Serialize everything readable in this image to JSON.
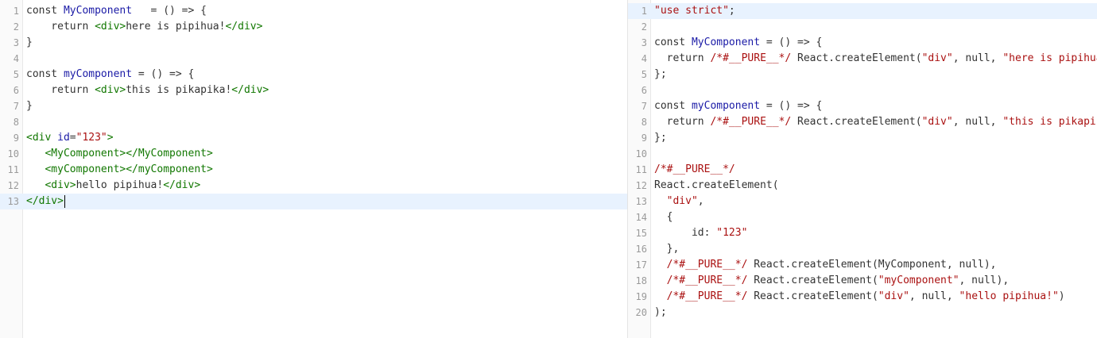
{
  "left_editor": {
    "lines": [
      {
        "n": "1",
        "parts": [
          [
            "kw",
            "const "
          ],
          [
            "fn",
            "MyComponent"
          ],
          [
            "kw",
            "   = () => {"
          ]
        ]
      },
      {
        "n": "2",
        "parts": [
          [
            "kw",
            "    return "
          ],
          [
            "tag",
            "<div>"
          ],
          [
            "kw",
            "here is pipihua!"
          ],
          [
            "tag",
            "</div>"
          ]
        ]
      },
      {
        "n": "3",
        "parts": [
          [
            "kw",
            "}"
          ]
        ]
      },
      {
        "n": "4",
        "parts": []
      },
      {
        "n": "5",
        "parts": [
          [
            "kw",
            "const "
          ],
          [
            "fn",
            "myComponent"
          ],
          [
            "kw",
            " = () => {"
          ]
        ]
      },
      {
        "n": "6",
        "parts": [
          [
            "kw",
            "    return "
          ],
          [
            "tag",
            "<div>"
          ],
          [
            "kw",
            "this is pikapika!"
          ],
          [
            "tag",
            "</div>"
          ]
        ]
      },
      {
        "n": "7",
        "parts": [
          [
            "kw",
            "}"
          ]
        ]
      },
      {
        "n": "8",
        "parts": []
      },
      {
        "n": "9",
        "parts": [
          [
            "tag",
            "<div "
          ],
          [
            "attr",
            "id"
          ],
          [
            "kw",
            "="
          ],
          [
            "str",
            "\"123\""
          ],
          [
            "tag",
            ">"
          ]
        ]
      },
      {
        "n": "10",
        "parts": [
          [
            "kw",
            "   "
          ],
          [
            "tag",
            "<MyComponent></MyComponent>"
          ]
        ]
      },
      {
        "n": "11",
        "parts": [
          [
            "kw",
            "   "
          ],
          [
            "tag",
            "<myComponent></myComponent>"
          ]
        ]
      },
      {
        "n": "12",
        "parts": [
          [
            "kw",
            "   "
          ],
          [
            "tag",
            "<div>"
          ],
          [
            "kw",
            "hello pipihua!"
          ],
          [
            "tag",
            "</div>"
          ]
        ]
      },
      {
        "n": "13",
        "parts": [
          [
            "tag",
            "</div>"
          ]
        ],
        "active": true,
        "caret": true
      }
    ]
  },
  "right_editor": {
    "lines": [
      {
        "n": "1",
        "parts": [
          [
            "str",
            "\"use strict\""
          ],
          [
            "kw",
            ";"
          ]
        ],
        "active": true
      },
      {
        "n": "2",
        "parts": []
      },
      {
        "n": "3",
        "parts": [
          [
            "kw",
            "const "
          ],
          [
            "fn",
            "MyComponent"
          ],
          [
            "kw",
            " = () => {"
          ]
        ]
      },
      {
        "n": "4",
        "parts": [
          [
            "kw",
            "  return "
          ],
          [
            "cm",
            "/*#__PURE__*/"
          ],
          [
            "kw",
            " React.createElement("
          ],
          [
            "str",
            "\"div\""
          ],
          [
            "kw",
            ", null, "
          ],
          [
            "str",
            "\"here is pipihua!\""
          ],
          [
            "kw",
            ");"
          ]
        ]
      },
      {
        "n": "5",
        "parts": [
          [
            "kw",
            "};"
          ]
        ]
      },
      {
        "n": "6",
        "parts": []
      },
      {
        "n": "7",
        "parts": [
          [
            "kw",
            "const "
          ],
          [
            "fn",
            "myComponent"
          ],
          [
            "kw",
            " = () => {"
          ]
        ]
      },
      {
        "n": "8",
        "parts": [
          [
            "kw",
            "  return "
          ],
          [
            "cm",
            "/*#__PURE__*/"
          ],
          [
            "kw",
            " React.createElement("
          ],
          [
            "str",
            "\"div\""
          ],
          [
            "kw",
            ", null, "
          ],
          [
            "str",
            "\"this is pikapika!\""
          ],
          [
            "kw",
            ");"
          ]
        ]
      },
      {
        "n": "9",
        "parts": [
          [
            "kw",
            "};"
          ]
        ]
      },
      {
        "n": "10",
        "parts": []
      },
      {
        "n": "11",
        "parts": [
          [
            "cm",
            "/*#__PURE__*/"
          ]
        ]
      },
      {
        "n": "12",
        "parts": [
          [
            "kw",
            "React.createElement("
          ]
        ]
      },
      {
        "n": "13",
        "parts": [
          [
            "kw",
            "  "
          ],
          [
            "str",
            "\"div\""
          ],
          [
            "kw",
            ","
          ]
        ]
      },
      {
        "n": "14",
        "parts": [
          [
            "kw",
            "  {"
          ]
        ]
      },
      {
        "n": "15",
        "parts": [
          [
            "kw",
            "      id: "
          ],
          [
            "str",
            "\"123\""
          ]
        ]
      },
      {
        "n": "16",
        "parts": [
          [
            "kw",
            "  },"
          ]
        ]
      },
      {
        "n": "17",
        "parts": [
          [
            "kw",
            "  "
          ],
          [
            "cm",
            "/*#__PURE__*/"
          ],
          [
            "kw",
            " React.createElement(MyComponent, null),"
          ]
        ]
      },
      {
        "n": "18",
        "parts": [
          [
            "kw",
            "  "
          ],
          [
            "cm",
            "/*#__PURE__*/"
          ],
          [
            "kw",
            " React.createElement("
          ],
          [
            "str",
            "\"myComponent\""
          ],
          [
            "kw",
            ", null),"
          ]
        ]
      },
      {
        "n": "19",
        "parts": [
          [
            "kw",
            "  "
          ],
          [
            "cm",
            "/*#__PURE__*/"
          ],
          [
            "kw",
            " React.createElement("
          ],
          [
            "str",
            "\"div\""
          ],
          [
            "kw",
            ", null, "
          ],
          [
            "str",
            "\"hello pipihua!\""
          ],
          [
            "kw",
            ")"
          ]
        ]
      },
      {
        "n": "20",
        "parts": [
          [
            "kw",
            ");"
          ]
        ]
      }
    ]
  }
}
